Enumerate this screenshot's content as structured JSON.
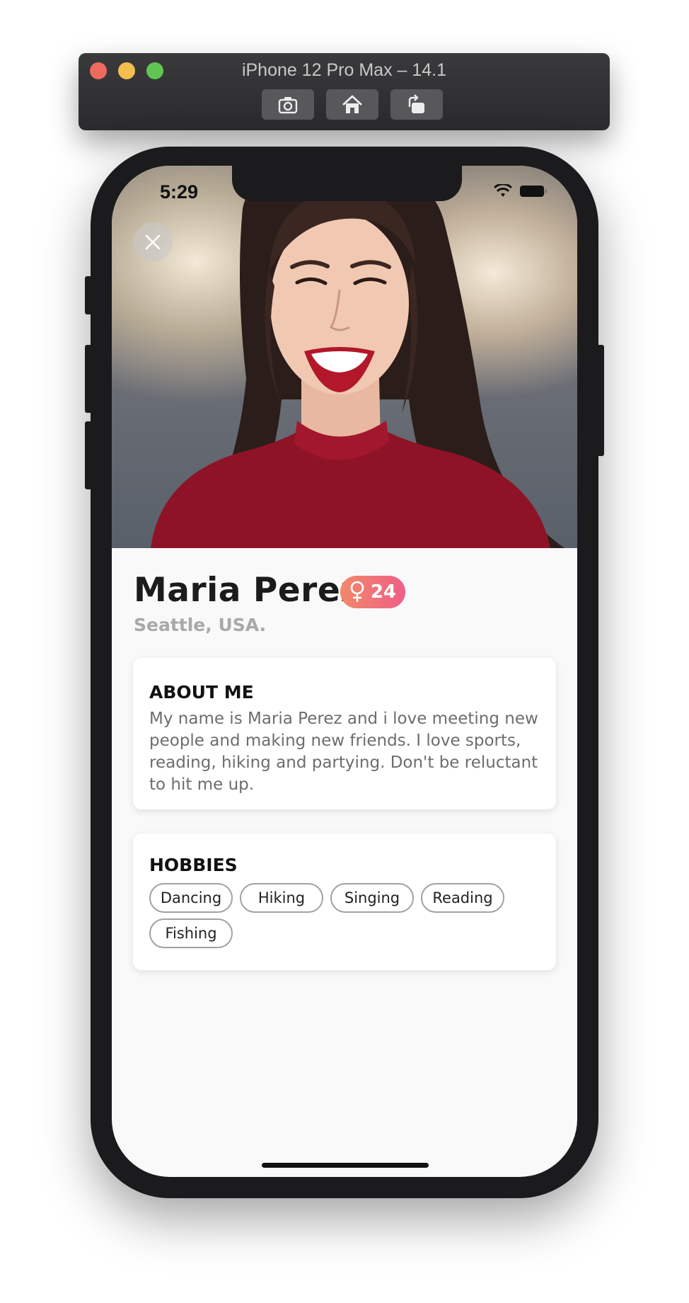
{
  "simulator": {
    "title": "iPhone 12 Pro Max – 14.1",
    "buttons": [
      "screenshot-icon",
      "home-icon",
      "rotate-icon"
    ]
  },
  "status_bar": {
    "time": "5:29"
  },
  "profile": {
    "name": "Maria Perez",
    "age": "24",
    "gender_icon": "female-icon",
    "location": "Seattle, USA."
  },
  "about": {
    "title": "ABOUT ME",
    "text": "My name is Maria Perez and i love meeting new people and making new friends. I love sports, reading, hiking and partying. Don't be reluctant to hit me up."
  },
  "hobbies": {
    "title": "HOBBIES",
    "items": [
      "Dancing",
      "Hiking",
      "Singing",
      "Reading",
      "Fishing"
    ]
  },
  "colors": {
    "badge_start": "#f2886a",
    "badge_end": "#ee5f86",
    "location_text": "#a9a9a9"
  }
}
